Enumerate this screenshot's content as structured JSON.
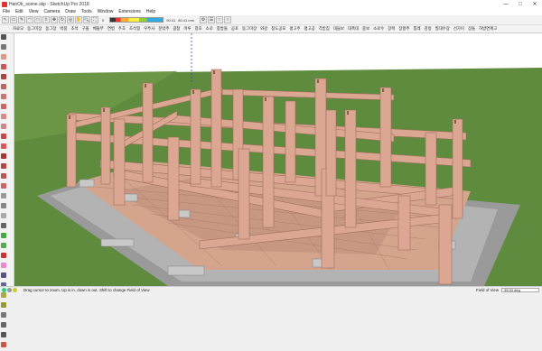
{
  "window": {
    "title": "HanOk_scene.skp - SketchUp Pro 2018",
    "controls": [
      "—",
      "□",
      "✕"
    ]
  },
  "menu": [
    "File",
    "Edit",
    "View",
    "Camera",
    "Draw",
    "Tools",
    "Window",
    "Extensions",
    "Help"
  ],
  "toolbar": {
    "scale_left": "0",
    "scale_right": "90.41",
    "zoom_text": "80.41 mm"
  },
  "plugin_bar": [
    "자료모",
    "동그미장",
    "동그장",
    "박풍",
    "초석",
    "구돌",
    "베돌부",
    "연병",
    "주초",
    "초석형",
    "우주사",
    "문밖주",
    "광창",
    "마루",
    "창호",
    "소로",
    "창방돌",
    "공포",
    "동그미장",
    "와강",
    "창도공포",
    "평고주",
    "평고공",
    "각받침",
    "대들보",
    "대촉대",
    "중보",
    "소로수",
    "장혁",
    "장항주",
    "통레",
    "감정",
    "질대수장",
    "선가이",
    "장돌",
    "하방연계고"
  ],
  "left_tools": [
    "select",
    "eraser",
    "paint",
    "line",
    "arc",
    "rect",
    "pushpull",
    "move",
    "rotate",
    "scale",
    "offset",
    "tape",
    "text",
    "orbit",
    "pan",
    "zoom",
    "walk",
    "section"
  ],
  "statusbar": {
    "hint": "Drag cursor to zoom. Up is in, down is out. Shift to change Field of View",
    "fov_label": "Field of View",
    "fov_value": "35.00 deg"
  },
  "colors": {
    "sky": "#ffffff",
    "grass": "#5e8b3d",
    "timber": "#dba792",
    "timber_dark": "#b88574",
    "stone": "#9a9a9a",
    "floor": "#d4a48c"
  }
}
